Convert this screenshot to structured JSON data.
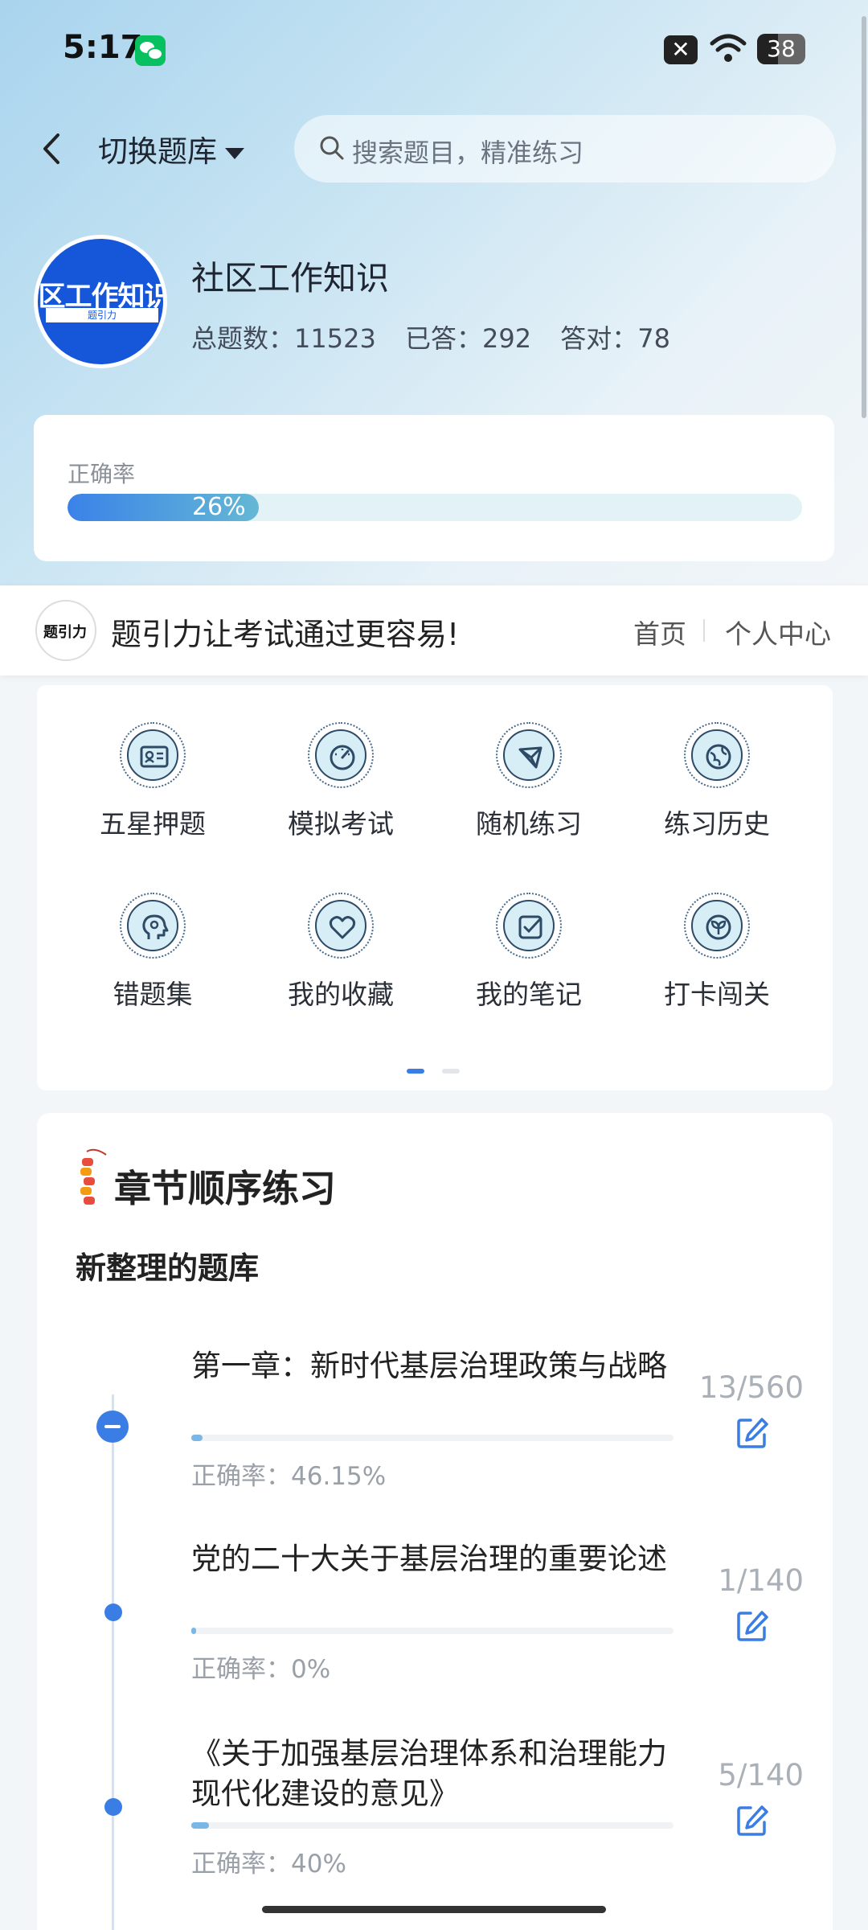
{
  "status": {
    "time": "5:17",
    "battery": "38"
  },
  "header": {
    "switch_label": "切换题库",
    "search_placeholder": "搜索题目，精准练习"
  },
  "bank": {
    "avatar_text": "区工作知识",
    "avatar_brand": "题引力",
    "title": "社区工作知识",
    "total_label": "总题数：11523",
    "answered_label": "已答：292",
    "correct_label": "答对：78"
  },
  "accuracy": {
    "label": "正确率",
    "value_text": "26%",
    "value": 26
  },
  "slogan_bar": {
    "logo_text": "题引力",
    "slogan": "题引力让考试通过更容易!",
    "nav_home": "首页",
    "nav_me": "个人中心"
  },
  "menu": {
    "items": [
      {
        "label": "五星押题",
        "icon": "id-card-icon"
      },
      {
        "label": "模拟考试",
        "icon": "gauge-icon"
      },
      {
        "label": "随机练习",
        "icon": "random-icon"
      },
      {
        "label": "练习历史",
        "icon": "globe-icon"
      },
      {
        "label": "错题集",
        "icon": "head-icon"
      },
      {
        "label": "我的收藏",
        "icon": "heart-icon"
      },
      {
        "label": "我的笔记",
        "icon": "note-check-icon"
      },
      {
        "label": "打卡闯关",
        "icon": "sprout-icon"
      }
    ],
    "page": 1,
    "pages": 2
  },
  "chapters": {
    "title": "章节顺序练习",
    "subtitle": "新整理的题库",
    "items": [
      {
        "name": "第一章：新时代基层治理政策与战略",
        "accuracy": "正确率：46.15%",
        "count": "13/560",
        "progress": 0.023,
        "expanded": true
      },
      {
        "name": "党的二十大关于基层治理的重要论述",
        "accuracy": "正确率：0%",
        "count": "1/140",
        "progress": 0.007,
        "expanded": false
      },
      {
        "name": "《关于加强基层治理体系和治理能力现代化建设的意见》",
        "accuracy": "正确率：40%",
        "count": "5/140",
        "progress": 0.036,
        "expanded": false
      }
    ]
  },
  "colors": {
    "accent": "#3a7de4",
    "brand_blue": "#1657d9"
  }
}
